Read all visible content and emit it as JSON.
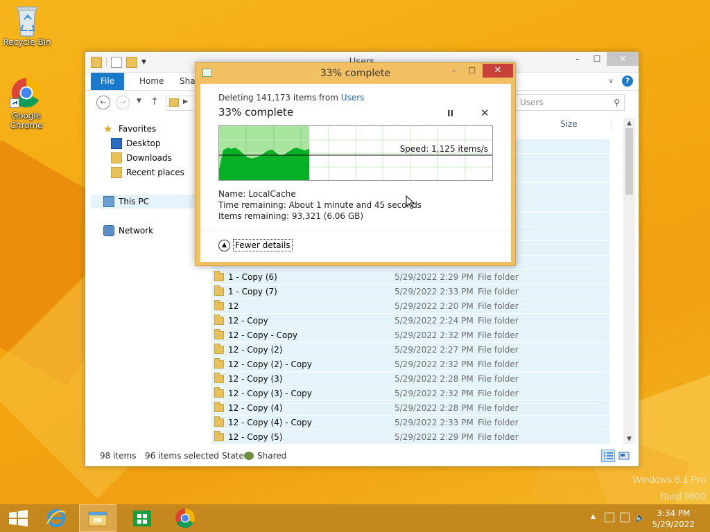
{
  "desktop": {
    "icons": [
      {
        "label": "Recycle Bin",
        "icon": "recycle-bin-icon"
      },
      {
        "label": "Google Chrome",
        "icon": "chrome-icon"
      }
    ],
    "watermark": {
      "line1": "Windows 8.1 Pro",
      "line2": "Build 9600"
    }
  },
  "explorer": {
    "title": "Users",
    "tabs": [
      {
        "label": "File"
      },
      {
        "label": "Home"
      },
      {
        "label": "Shar"
      }
    ],
    "search_placeholder": "Users",
    "help_label": "?",
    "nav": {
      "favorites": "Favorites",
      "desktop": "Desktop",
      "downloads": "Downloads",
      "recent": "Recent places",
      "this_pc": "This PC",
      "network": "Network"
    },
    "columns": {
      "size": "Size"
    },
    "rows": [
      {
        "name": "1 - Copy (6)",
        "date": "5/29/2022 2:29 PM",
        "type": "File folder"
      },
      {
        "name": "1 - Copy (7)",
        "date": "5/29/2022 2:33 PM",
        "type": "File folder"
      },
      {
        "name": "12",
        "date": "5/29/2022 2:20 PM",
        "type": "File folder"
      },
      {
        "name": "12 - Copy",
        "date": "5/29/2022 2:24 PM",
        "type": "File folder"
      },
      {
        "name": "12 - Copy - Copy",
        "date": "5/29/2022 2:32 PM",
        "type": "File folder"
      },
      {
        "name": "12 - Copy (2)",
        "date": "5/29/2022 2:27 PM",
        "type": "File folder"
      },
      {
        "name": "12 - Copy (2) - Copy",
        "date": "5/29/2022 2:32 PM",
        "type": "File folder"
      },
      {
        "name": "12 - Copy (3)",
        "date": "5/29/2022 2:28 PM",
        "type": "File folder"
      },
      {
        "name": "12 - Copy (3) - Copy",
        "date": "5/29/2022 2:32 PM",
        "type": "File folder"
      },
      {
        "name": "12 - Copy (4)",
        "date": "5/29/2022 2:28 PM",
        "type": "File folder"
      },
      {
        "name": "12 - Copy (4) - Copy",
        "date": "5/29/2022 2:33 PM",
        "type": "File folder"
      },
      {
        "name": "12 - Copy (5)",
        "date": "5/29/2022 2:29 PM",
        "type": "File folder"
      }
    ],
    "status": {
      "items": "98 items",
      "selected": "96 items selected",
      "state_label": "State:",
      "state_value": "Shared"
    }
  },
  "dialog": {
    "title": "33% complete",
    "line_prefix": "Deleting 141,173 items from ",
    "line_link": "Users",
    "heading": "33% complete",
    "pause_glyph": "II",
    "cancel_glyph": "✕",
    "progress_percent": 33,
    "speed": "Speed: 1,125 items/s",
    "name_label": "Name:",
    "name_value": "LocalCache",
    "time_label": "Time remaining:",
    "time_value": "About 1 minute and 45 seconds",
    "items_label": "Items remaining:",
    "items_value": "93,321 (6.06 GB)",
    "fewer_details": "Fewer details",
    "min_glyph": "–",
    "max_glyph": "☐",
    "close_glyph": "✕"
  },
  "taskbar": {
    "time": "3:34 PM",
    "date": "5/29/2022",
    "tray_up": "▲"
  },
  "colors": {
    "accent": "#1979ca",
    "dialog_frame": "#f2c062",
    "graph_fill": "#06b025",
    "graph_light": "#a8e6a0",
    "close_red": "#c7403a",
    "taskbar": "#c4881e"
  }
}
